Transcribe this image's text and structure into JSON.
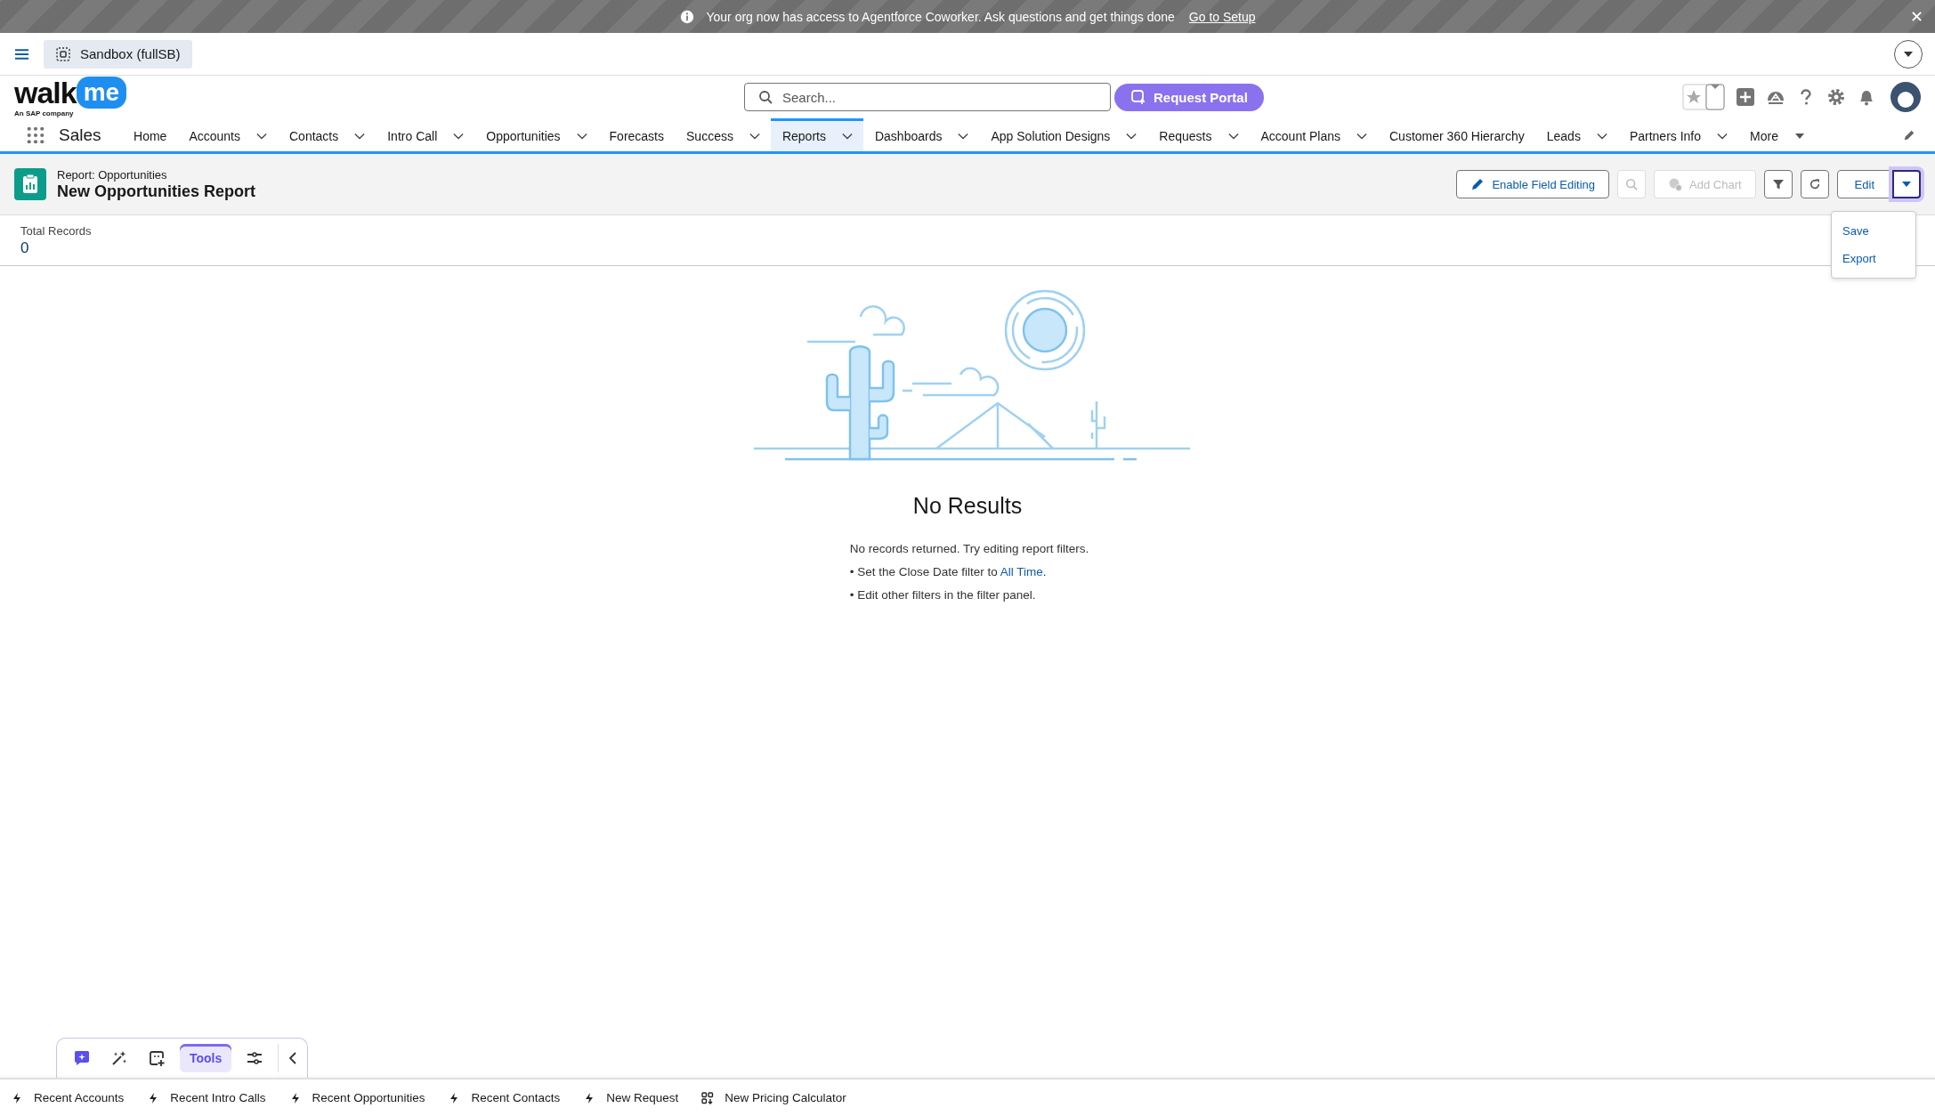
{
  "banner": {
    "message": "Your org now has access to Agentforce Coworker. Ask questions and get things done",
    "link": "Go to Setup"
  },
  "sandbox": {
    "label": "Sandbox (fullSB)"
  },
  "logo": {
    "word": "walk",
    "badge": "me",
    "tagline": "An SAP company"
  },
  "search": {
    "placeholder": "Search..."
  },
  "request_portal": {
    "label": "Request Portal"
  },
  "app_name": "Sales",
  "nav": [
    {
      "label": "Home",
      "dropdown": false,
      "selected": false
    },
    {
      "label": "Accounts",
      "dropdown": true,
      "selected": false
    },
    {
      "label": "Contacts",
      "dropdown": true,
      "selected": false
    },
    {
      "label": "Intro Call",
      "dropdown": true,
      "selected": false
    },
    {
      "label": "Opportunities",
      "dropdown": true,
      "selected": false
    },
    {
      "label": "Forecasts",
      "dropdown": false,
      "selected": false
    },
    {
      "label": "Success",
      "dropdown": true,
      "selected": false
    },
    {
      "label": "Reports",
      "dropdown": true,
      "selected": true
    },
    {
      "label": "Dashboards",
      "dropdown": true,
      "selected": false
    },
    {
      "label": "App Solution Designs",
      "dropdown": true,
      "selected": false
    },
    {
      "label": "Requests",
      "dropdown": true,
      "selected": false
    },
    {
      "label": "Account Plans",
      "dropdown": true,
      "selected": false
    },
    {
      "label": "Customer 360 Hierarchy",
      "dropdown": false,
      "selected": false
    },
    {
      "label": "Leads",
      "dropdown": true,
      "selected": false
    },
    {
      "label": "Partners Info",
      "dropdown": true,
      "selected": false
    }
  ],
  "nav_more": "More",
  "report": {
    "type": "Report: Opportunities",
    "title": "New Opportunities Report"
  },
  "actions": {
    "enable_field_editing": "Enable Field Editing",
    "add_chart": "Add Chart",
    "edit": "Edit"
  },
  "menu": [
    {
      "label": "Save"
    },
    {
      "label": "Export"
    }
  ],
  "total_records": {
    "label": "Total Records",
    "value": "0"
  },
  "empty": {
    "title": "No Results",
    "intro": "No records returned. Try editing report filters.",
    "hint1_before": "• Set the Close Date filter to ",
    "hint1_link": "All Time",
    "hint1_after": ".",
    "hint2": "• Edit other filters in the filter panel."
  },
  "tools": {
    "tabs": [
      {
        "kind": "chat",
        "selected": false
      },
      {
        "kind": "wand",
        "selected": false
      },
      {
        "kind": "frame",
        "selected": false
      },
      {
        "kind": "label",
        "label": "Tools",
        "selected": true
      },
      {
        "kind": "sliders",
        "selected": false
      }
    ]
  },
  "utility": [
    {
      "kind": "bolt",
      "label": "Recent Accounts"
    },
    {
      "kind": "bolt",
      "label": "Recent Intro Calls"
    },
    {
      "kind": "bolt",
      "label": "Recent Opportunities"
    },
    {
      "kind": "bolt",
      "label": "Recent Contacts"
    },
    {
      "kind": "bolt",
      "label": "New Request"
    },
    {
      "kind": "grid",
      "label": "New Pricing Calculator"
    }
  ]
}
